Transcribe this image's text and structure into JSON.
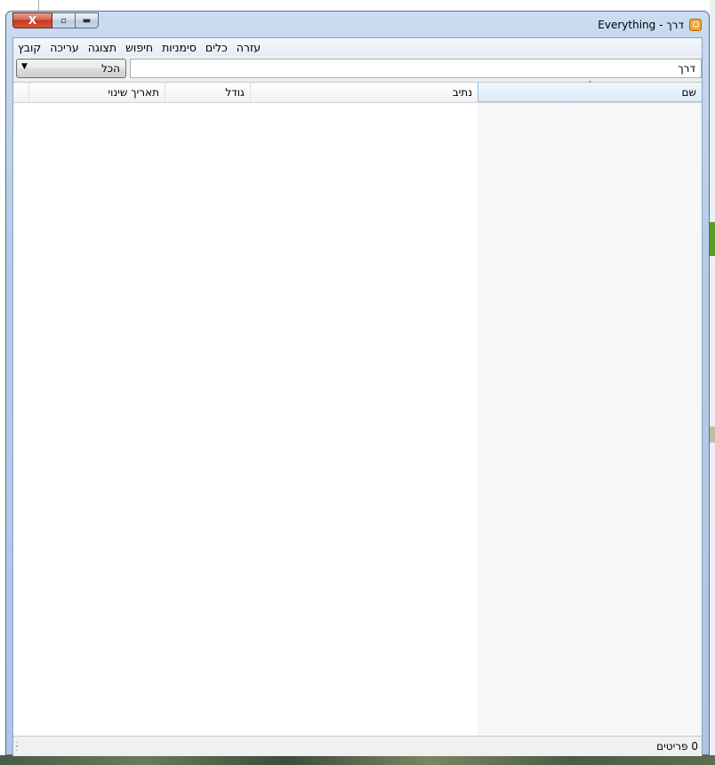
{
  "window": {
    "title": "דרך - Everything",
    "close_label": "X",
    "max_label": "▫",
    "min_label": "▬"
  },
  "menu": [
    {
      "label": "קובץ"
    },
    {
      "label": "עריכה"
    },
    {
      "label": "תצוגה"
    },
    {
      "label": "חיפוש"
    },
    {
      "label": "סימניות"
    },
    {
      "label": "כלים"
    },
    {
      "label": "עזרה"
    }
  ],
  "search": {
    "value": "דרך",
    "filter_selected": "הכל"
  },
  "columns": {
    "name": "שם",
    "path": "נתיב",
    "size": "גודל",
    "date_modified": "תאריך שינוי"
  },
  "status": {
    "items_text": "0 פריטים"
  },
  "colors": {
    "titlebar": "#b6cde9",
    "selected_column": "#dcecfa",
    "close_button": "#c2381c"
  }
}
